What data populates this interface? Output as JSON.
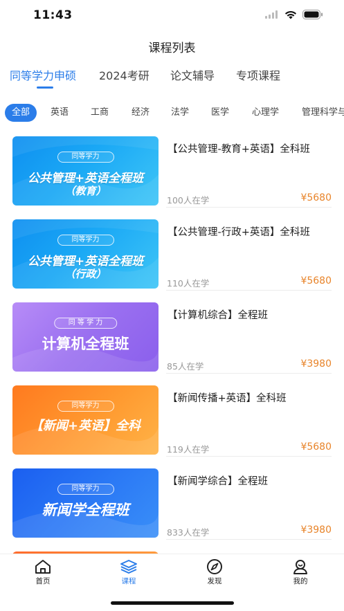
{
  "status": {
    "time": "11:43"
  },
  "header": {
    "title": "课程列表"
  },
  "tabs": [
    {
      "label": "同等学力申硕",
      "active": true
    },
    {
      "label": "2024考研",
      "active": false
    },
    {
      "label": "论文辅导",
      "active": false
    },
    {
      "label": "专项课程",
      "active": false
    }
  ],
  "categories": [
    "全部",
    "英语",
    "工商",
    "经济",
    "法学",
    "医学",
    "心理学",
    "管理科学与"
  ],
  "courses": [
    {
      "tag": "同等学力",
      "line1": "公共管理+英语全程班",
      "line2": "（教育）",
      "title": "【公共管理-教育+英语】全科班",
      "learners": "100人在学",
      "price": "¥5680",
      "theme": "blue"
    },
    {
      "tag": "同等学力",
      "line1": "公共管理+英语全程班",
      "line2": "（行政）",
      "title": "【公共管理-行政+英语】全科班",
      "learners": "110人在学",
      "price": "¥5680",
      "theme": "blue"
    },
    {
      "tag": "同 等 学 力",
      "line1": "计算机全程班",
      "line2": "",
      "title": "【计算机综合】全程班",
      "learners": "85人在学",
      "price": "¥3980",
      "theme": "purple"
    },
    {
      "tag": "同等学力",
      "line1": "【新闻+英语】全科",
      "line2": "",
      "title": "【新闻传播+英语】全科班",
      "learners": "119人在学",
      "price": "¥5680",
      "theme": "orange"
    },
    {
      "tag": "同等学力",
      "line1": "新闻学全程班",
      "line2": "",
      "title": "【新闻学综合】全程班",
      "learners": "833人在学",
      "price": "¥3980",
      "theme": "deepblue"
    }
  ],
  "bottom_nav": [
    {
      "label": "首页",
      "icon": "home-icon",
      "active": false
    },
    {
      "label": "课程",
      "icon": "layers-icon",
      "active": true
    },
    {
      "label": "发现",
      "icon": "compass-icon",
      "active": false
    },
    {
      "label": "我的",
      "icon": "user-icon",
      "active": false
    }
  ],
  "colors": {
    "accent": "#2b7de9",
    "price": "#e8842a"
  }
}
